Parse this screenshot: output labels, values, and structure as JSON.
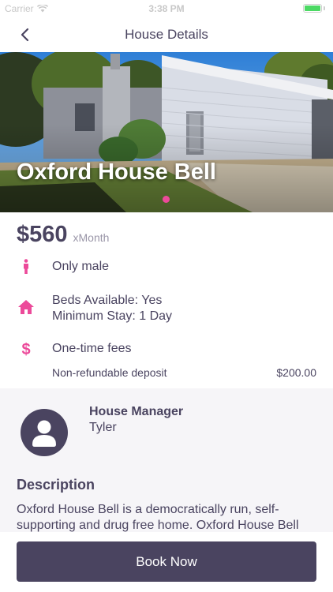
{
  "status_bar": {
    "carrier": "Carrier",
    "time": "3:38 PM"
  },
  "nav": {
    "title": "House Details",
    "back_icon": "chevron-left-icon"
  },
  "hero": {
    "title": "Oxford House Bell",
    "page_dots_count": 1,
    "active_dot_color": "#ec4a9a"
  },
  "price": {
    "amount": "$560",
    "unit": "xMonth"
  },
  "gender": {
    "icon": "male-person-icon",
    "text": "Only male"
  },
  "availability": {
    "icon": "home-icon",
    "line1": "Beds Available: Yes",
    "line2": "Minimum Stay: 1 Day"
  },
  "fees": {
    "icon": "dollar-icon",
    "title": "One-time fees",
    "items": [
      {
        "label": "Non-refundable deposit",
        "amount": "$200.00"
      }
    ]
  },
  "manager": {
    "heading": "House Manager",
    "name": "Tyler",
    "avatar_icon": "user-avatar-icon"
  },
  "description": {
    "heading": "Description",
    "text": "Oxford House Bell is a democratically run, self-supporting and drug free home. Oxford House Bell"
  },
  "book_button": {
    "label": "Book Now"
  },
  "colors": {
    "primary": "#4a4460",
    "accent": "#ec4a9a",
    "section_bg": "#f6f5f8"
  }
}
